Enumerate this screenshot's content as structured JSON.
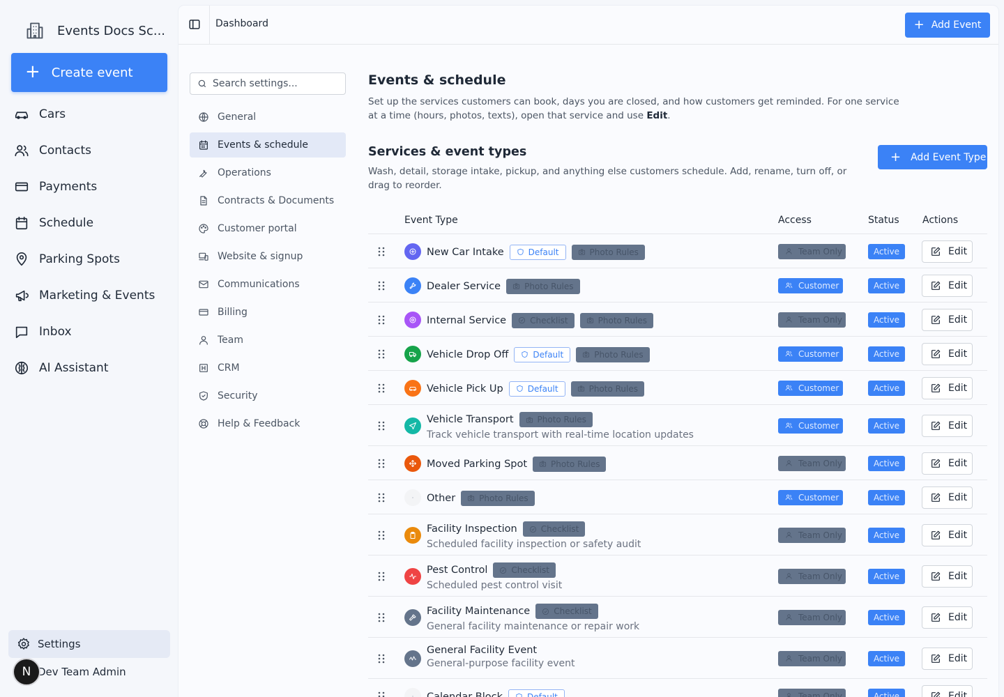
{
  "app": {
    "name": "Events Docs Sc...",
    "create_label": "Create event"
  },
  "nav": [
    {
      "label": "Cars",
      "icon": "car-icon"
    },
    {
      "label": "Contacts",
      "icon": "users-icon"
    },
    {
      "label": "Payments",
      "icon": "credit-card-icon"
    },
    {
      "label": "Schedule",
      "icon": "calendar-icon"
    },
    {
      "label": "Parking Spots",
      "icon": "map-pin-icon"
    },
    {
      "label": "Marketing & Events",
      "icon": "megaphone-icon"
    },
    {
      "label": "Inbox",
      "icon": "inbox-icon"
    },
    {
      "label": "AI Assistant",
      "icon": "brain-icon"
    }
  ],
  "settings_label": "Settings",
  "user": {
    "initial": "N",
    "name": "Dev Team Admin"
  },
  "topbar": {
    "breadcrumb": "Dashboard",
    "add_event_label": "Add Event"
  },
  "settings_nav": {
    "search_placeholder": "Search settings...",
    "items": [
      {
        "label": "General",
        "icon": "globe-icon"
      },
      {
        "label": "Events & schedule",
        "icon": "calendar-icon",
        "active": true
      },
      {
        "label": "Operations",
        "icon": "wrench-icon"
      },
      {
        "label": "Contracts & Documents",
        "icon": "file-icon"
      },
      {
        "label": "Customer portal",
        "icon": "palette-icon"
      },
      {
        "label": "Website & signup",
        "icon": "devices-icon"
      },
      {
        "label": "Communications",
        "icon": "mail-icon"
      },
      {
        "label": "Billing",
        "icon": "credit-card-icon"
      },
      {
        "label": "Team",
        "icon": "user-icon"
      },
      {
        "label": "CRM",
        "icon": "crm-icon"
      },
      {
        "label": "Security",
        "icon": "shield-icon"
      },
      {
        "label": "Help & Feedback",
        "icon": "lifebuoy-icon"
      }
    ]
  },
  "page": {
    "title": "Events & schedule",
    "description_pre": "Set up the services customers can book, days you are closed, and how customers get reminded. For one service at a time (hours, photos, texts), open that service and use ",
    "description_bold": "Edit",
    "description_post": ".",
    "section_title": "Services & event types",
    "section_description": "Wash, detail, storage intake, pickup, and anything else customers schedule. Add, rename, turn off, or drag to reorder.",
    "add_type_label": "Add Event Type"
  },
  "table": {
    "headers": {
      "type": "Event Type",
      "access": "Access",
      "status": "Status",
      "actions": "Actions"
    },
    "edit_label": "Edit",
    "rows": [
      {
        "name": "New Car Intake",
        "color": "#6366f1",
        "icon": "intake-icon",
        "tags": [
          "Default",
          "Photo Rules"
        ],
        "access": "Team Only",
        "status": "Active"
      },
      {
        "name": "Dealer Service",
        "color": "#3b82f6",
        "icon": "wrench-icon",
        "tags": [
          "Photo Rules"
        ],
        "access": "Customer",
        "status": "Active"
      },
      {
        "name": "Internal Service",
        "color": "#a855f7",
        "icon": "gear-icon",
        "tags": [
          "Checklist",
          "Photo Rules"
        ],
        "access": "Team Only",
        "status": "Active"
      },
      {
        "name": "Vehicle Drop Off",
        "color": "#16a34a",
        "icon": "truck-icon",
        "tags": [
          "Default",
          "Photo Rules"
        ],
        "access": "Customer",
        "status": "Active"
      },
      {
        "name": "Vehicle Pick Up",
        "color": "#f97316",
        "icon": "car-icon",
        "tags": [
          "Default",
          "Photo Rules"
        ],
        "access": "Customer",
        "status": "Active"
      },
      {
        "name": "Vehicle Transport",
        "color": "#14b8a6",
        "icon": "send-icon",
        "tags": [
          "Photo Rules"
        ],
        "access": "Customer",
        "status": "Active",
        "desc": "Track vehicle transport with real-time location updates"
      },
      {
        "name": "Moved Parking Spot",
        "color": "#ea580c",
        "icon": "move-icon",
        "tags": [
          "Photo Rules"
        ],
        "access": "Team Only",
        "status": "Active"
      },
      {
        "name": "Other",
        "color": "#f3f4f6",
        "icon": "dot-icon",
        "tags": [
          "Photo Rules"
        ],
        "access": "Customer",
        "status": "Active"
      },
      {
        "name": "Facility Inspection",
        "color": "#ea8a0c",
        "icon": "clipboard-icon",
        "tags": [
          "Checklist"
        ],
        "access": "Team Only",
        "status": "Active",
        "desc": "Scheduled facility inspection or safety audit"
      },
      {
        "name": "Pest Control",
        "color": "#ef4444",
        "icon": "activity-icon",
        "tags": [
          "Checklist"
        ],
        "access": "Team Only",
        "status": "Active",
        "desc": "Scheduled pest control visit"
      },
      {
        "name": "Facility Maintenance",
        "color": "#64748b",
        "icon": "hammer-icon",
        "tags": [
          "Checklist"
        ],
        "access": "Team Only",
        "status": "Active",
        "desc": "General facility maintenance or repair work"
      },
      {
        "name": "General Facility Event",
        "color": "#64748b",
        "icon": "pulse-icon",
        "tags": [],
        "access": "Team Only",
        "status": "Active",
        "desc": "General-purpose facility event"
      },
      {
        "name": "Calendar Block",
        "color": "#f3f4f6",
        "icon": "dot-icon",
        "tags": [
          "Default"
        ],
        "access": "Team Only",
        "status": "Active"
      }
    ]
  }
}
